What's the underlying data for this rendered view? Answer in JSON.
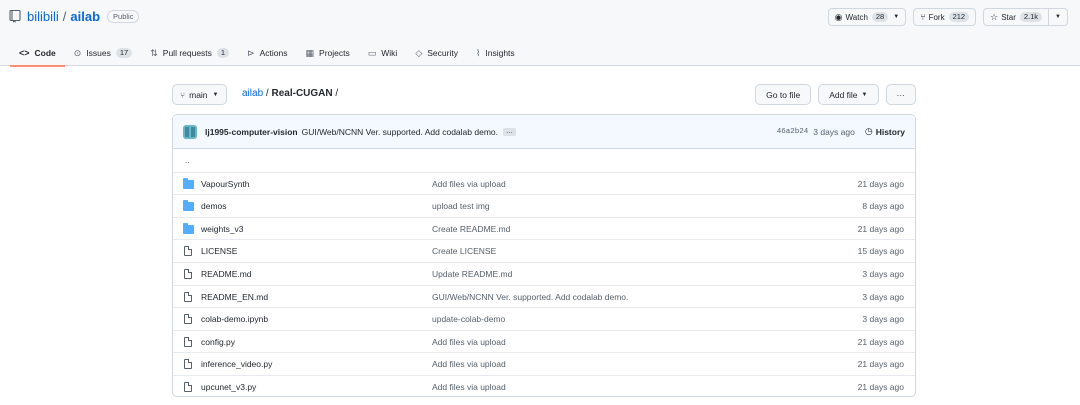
{
  "repo": {
    "owner": "bilibili",
    "separator": "/",
    "name": "ailab",
    "visibility": "Public"
  },
  "actions": {
    "watch_label": "Watch",
    "watch_count": "28",
    "fork_label": "Fork",
    "fork_count": "212",
    "star_label": "Star",
    "star_count": "2.1k"
  },
  "tabs": [
    {
      "label": "Code",
      "icon": "code-icon",
      "active": true
    },
    {
      "label": "Issues",
      "count": "17",
      "icon": "issue-icon"
    },
    {
      "label": "Pull requests",
      "count": "1",
      "icon": "pull-request-icon"
    },
    {
      "label": "Actions",
      "icon": "play-icon"
    },
    {
      "label": "Projects",
      "icon": "table-icon"
    },
    {
      "label": "Wiki",
      "icon": "book-icon"
    },
    {
      "label": "Security",
      "icon": "shield-icon"
    },
    {
      "label": "Insights",
      "icon": "graph-icon"
    }
  ],
  "file_nav": {
    "branch": "main",
    "crumb_repo": "ailab",
    "crumb_sep": " / ",
    "crumb_current": "Real-CUGAN",
    "crumb_trailing": " /",
    "go_to_file": "Go to file",
    "add_file": "Add file",
    "more": "···"
  },
  "commit": {
    "author": "lj1995-computer-vision",
    "message": "GUI/Web/NCNN Ver. supported. Add codalab demo.",
    "more": "…",
    "sha": "46a2b24",
    "age": "3 days ago",
    "history_label": "History"
  },
  "parent_dir": "..",
  "files": [
    {
      "type": "folder",
      "name": "VapourSynth",
      "message": "Add files via upload",
      "age": "21 days ago"
    },
    {
      "type": "folder",
      "name": "demos",
      "message": "upload test img",
      "age": "8 days ago"
    },
    {
      "type": "folder",
      "name": "weights_v3",
      "message": "Create README.md",
      "age": "21 days ago"
    },
    {
      "type": "file",
      "name": "LICENSE",
      "message": "Create LICENSE",
      "age": "15 days ago"
    },
    {
      "type": "file",
      "name": "README.md",
      "message": "Update README.md",
      "age": "3 days ago"
    },
    {
      "type": "file",
      "name": "README_EN.md",
      "message": "GUI/Web/NCNN Ver. supported. Add codalab demo.",
      "age": "3 days ago"
    },
    {
      "type": "file",
      "name": "colab-demo.ipynb",
      "message": "update-colab-demo",
      "age": "3 days ago"
    },
    {
      "type": "file",
      "name": "config.py",
      "message": "Add files via upload",
      "age": "21 days ago"
    },
    {
      "type": "file",
      "name": "inference_video.py",
      "message": "Add files via upload",
      "age": "21 days ago"
    },
    {
      "type": "file",
      "name": "upcunet_v3.py",
      "message": "Add files via upload",
      "age": "21 days ago"
    }
  ],
  "colors": {
    "link": "#0969da",
    "active_tab_underline": "#fd8c73",
    "folder": "#54aeff",
    "commit_bar_bg": "#f3f9ff"
  }
}
